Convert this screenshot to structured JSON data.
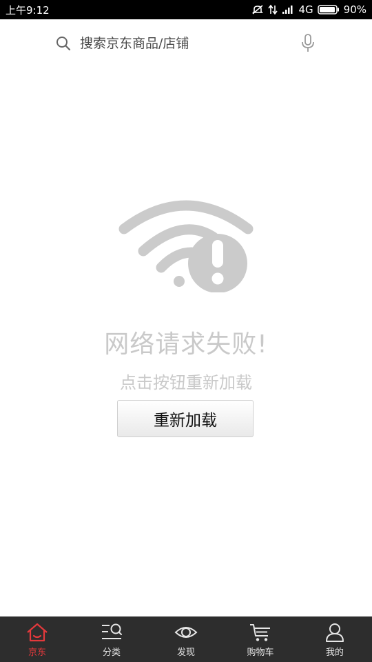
{
  "status_bar": {
    "time": "上午9:12",
    "network": "4G",
    "battery": "90%"
  },
  "search": {
    "placeholder": "搜索京东商品/店铺"
  },
  "error": {
    "title": "网络请求失败!",
    "subtitle": "点击按钮重新加载",
    "reload_label": "重新加载"
  },
  "tabs": [
    {
      "label": "京东",
      "icon": "home-icon",
      "active": true
    },
    {
      "label": "分类",
      "icon": "category-icon",
      "active": false
    },
    {
      "label": "发现",
      "icon": "eye-icon",
      "active": false
    },
    {
      "label": "购物车",
      "icon": "cart-icon",
      "active": false
    },
    {
      "label": "我的",
      "icon": "user-icon",
      "active": false
    }
  ],
  "colors": {
    "accent": "#e4393c",
    "tabbar_bg": "#2d2d2d",
    "muted_text": "#c9c9c9"
  }
}
